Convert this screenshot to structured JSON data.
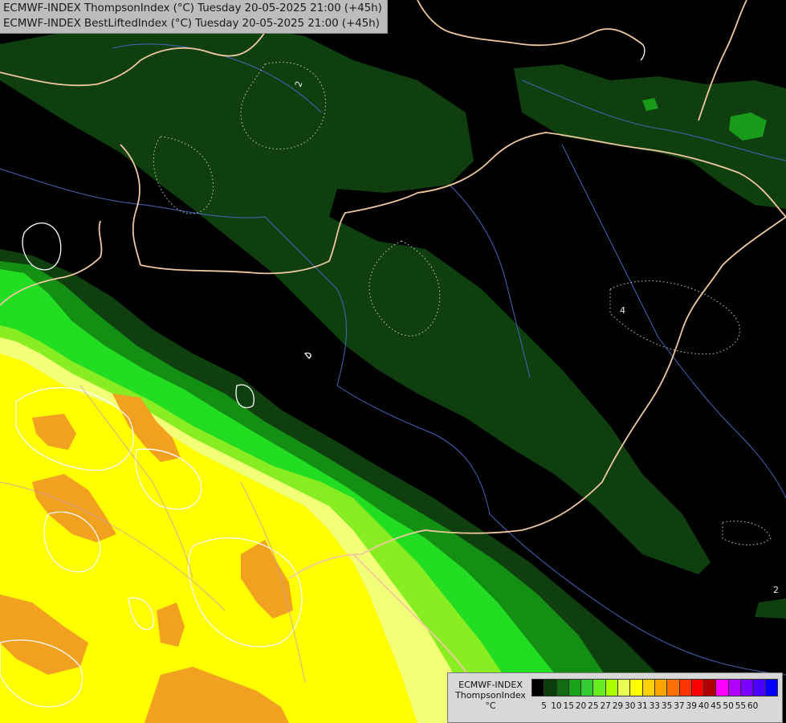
{
  "header": {
    "line1": "ECMWF-INDEX ThompsonIndex (°C) Tuesday 20-05-2025 21:00 (+45h)",
    "line2": "ECMWF-INDEX BestLiftedIndex (°C) Tuesday 20-05-2025 21:00 (+45h)"
  },
  "legend": {
    "model": "ECMWF-INDEX",
    "parameter": "ThompsonIndex",
    "unit": "°C",
    "colors": [
      "#000000",
      "#0a3d0a",
      "#126b12",
      "#1aa21a",
      "#33cc33",
      "#66ee22",
      "#aaff00",
      "#eaff55",
      "#ffff00",
      "#ffd000",
      "#ffa500",
      "#ff7000",
      "#ff3300",
      "#ff0000",
      "#b20000",
      "#ff00ff",
      "#b400ff",
      "#7a00ff",
      "#4b00ff",
      "#0000ff"
    ],
    "ticks": [
      "5",
      "10",
      "15",
      "20",
      "25",
      "27",
      "29",
      "30",
      "31",
      "33",
      "35",
      "37",
      "39",
      "40",
      "45",
      "50",
      "55",
      "60"
    ]
  },
  "contour_labels": [
    {
      "name": "contour-label-2-north",
      "text": "2"
    },
    {
      "name": "contour-label-4-east",
      "text": "4"
    },
    {
      "name": "contour-label-2-southeast",
      "text": "2"
    }
  ]
}
